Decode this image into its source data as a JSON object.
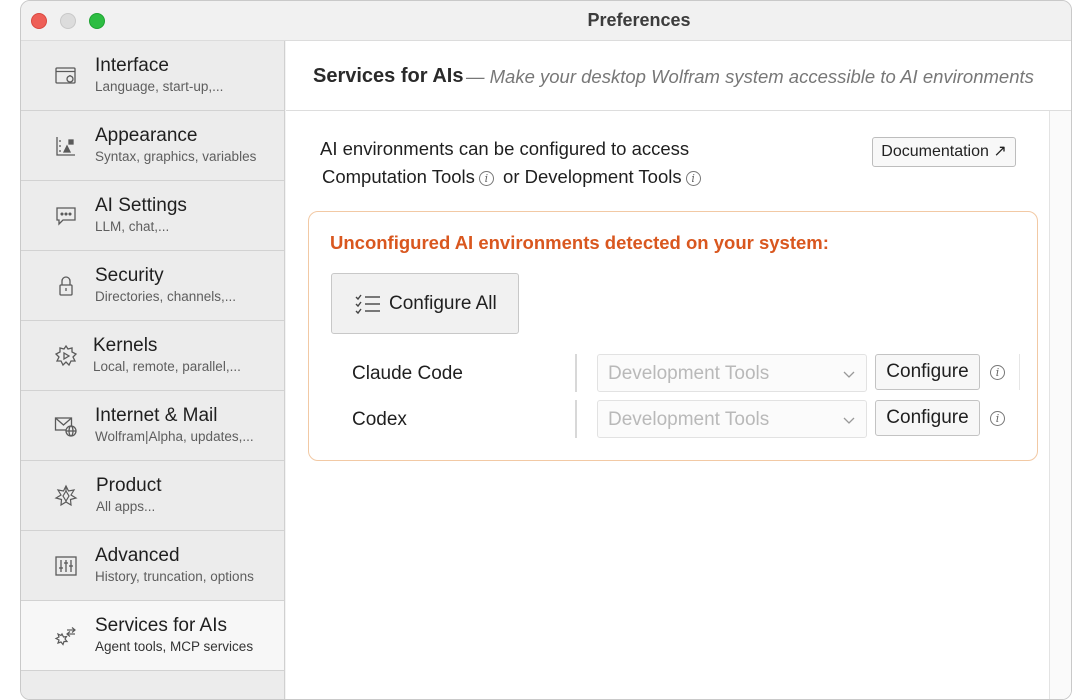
{
  "window": {
    "title": "Preferences"
  },
  "sidebar": {
    "items": [
      {
        "label": "Interface",
        "sub": "Language, start-up,...",
        "icon": "interface-icon"
      },
      {
        "label": "Appearance",
        "sub": "Syntax, graphics, variables",
        "icon": "appearance-icon"
      },
      {
        "label": "AI Settings",
        "sub": "LLM, chat,...",
        "icon": "chat-icon"
      },
      {
        "label": "Security",
        "sub": "Directories, channels,...",
        "icon": "lock-icon"
      },
      {
        "label": "Kernels",
        "sub": "Local, remote, parallel,...",
        "icon": "kernel-icon"
      },
      {
        "label": "Internet & Mail",
        "sub": "Wolfram|Alpha, updates,...",
        "icon": "mail-globe-icon"
      },
      {
        "label": "Product",
        "sub": "All apps...",
        "icon": "wolfram-star-icon"
      },
      {
        "label": "Advanced",
        "sub": "History, truncation, options",
        "icon": "sliders-icon"
      },
      {
        "label": "Services for AIs",
        "sub": "Agent tools, MCP services",
        "icon": "services-icon",
        "active": true
      }
    ]
  },
  "header": {
    "title": "Services for AIs",
    "subtitle": "— Make your desktop Wolfram system accessible to AI environments"
  },
  "intro": {
    "line1": "AI environments can be configured to access",
    "computation_tools": "Computation Tools",
    "or": "or",
    "development_tools": "Development Tools"
  },
  "documentation_button": "Documentation ↗",
  "warning": {
    "title": "Unconfigured AI environments detected on your system:",
    "configure_all": "Configure All"
  },
  "environments": [
    {
      "name": "Claude Code",
      "tools": "Development Tools",
      "button": "Configure"
    },
    {
      "name": "Codex",
      "tools": "Development Tools",
      "button": "Configure"
    }
  ],
  "colors": {
    "warning_text": "#d9571f",
    "warning_border": "#f2c9a4",
    "close": "#ee5f57",
    "maximize": "#2dbd42"
  }
}
